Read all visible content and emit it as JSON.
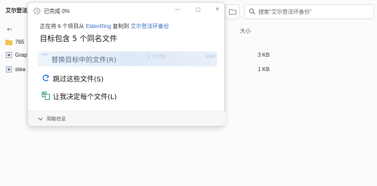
{
  "explorer": {
    "window_title": "艾尔登法",
    "nav_arrow": "←",
    "search_placeholder": "搜索\"艾尔登法环备份\"",
    "size_column": "大小",
    "rows": [
      {
        "name": "765",
        "size": ""
      },
      {
        "name": "Grap",
        "size": "3 KB"
      },
      {
        "name": "stea",
        "size": "1 KB"
      }
    ]
  },
  "dialog": {
    "title": "已完成 0%",
    "minimize": "—",
    "maximize": "□",
    "close": "✕",
    "from_prefix": "正在将 6 个项目从 ",
    "from_source": "EldenRing",
    "from_mid": " 复制到 ",
    "from_target": "艾尔登法环备份",
    "conflict_text": "目标包含 5 个同名文件",
    "options": {
      "replace": "替换目标中的文件(R)",
      "replace_ghost": "2 23:55",
      "replace_ghost2": "30M",
      "skip": "跳过这些文件(S)",
      "decide": "让我决定每个文件(L)"
    },
    "footer": "简略信息"
  },
  "colors": {
    "link": "#3a6fc0",
    "folder": "#f2c14e",
    "skip_arrow": "#2e6ed6",
    "decide_icon": "#1a9a5a"
  }
}
